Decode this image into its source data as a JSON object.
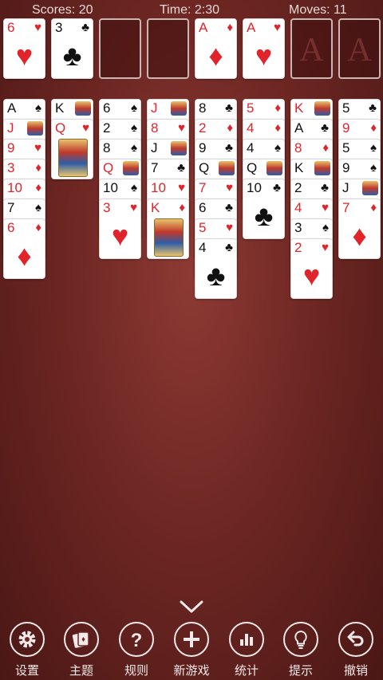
{
  "header": {
    "score": "Scores: 20",
    "time": "Time: 2:30",
    "moves": "Moves: 11"
  },
  "freecells": [
    {
      "rank": "6",
      "suit": "♥",
      "color": "red"
    },
    {
      "rank": "3",
      "suit": "♣",
      "color": "black"
    },
    null,
    null
  ],
  "foundations": [
    {
      "rank": "A",
      "suit": "♦",
      "color": "red"
    },
    {
      "rank": "A",
      "suit": "♥",
      "color": "red"
    },
    {
      "ghost": "A"
    },
    {
      "ghost": "A"
    }
  ],
  "tableau": [
    [
      {
        "rank": "A",
        "suit": "♠"
      },
      {
        "rank": "J",
        "suit": "♦"
      },
      {
        "rank": "9",
        "suit": "♥"
      },
      {
        "rank": "3",
        "suit": "♦"
      },
      {
        "rank": "10",
        "suit": "♦"
      },
      {
        "rank": "7",
        "suit": "♠"
      },
      {
        "rank": "6",
        "suit": "♦"
      }
    ],
    [
      {
        "rank": "K",
        "suit": "♠"
      },
      {
        "rank": "Q",
        "suit": "♥"
      }
    ],
    [
      {
        "rank": "6",
        "suit": "♠"
      },
      {
        "rank": "2",
        "suit": "♠"
      },
      {
        "rank": "8",
        "suit": "♠"
      },
      {
        "rank": "Q",
        "suit": "♦"
      },
      {
        "rank": "10",
        "suit": "♠"
      },
      {
        "rank": "3",
        "suit": "♥"
      }
    ],
    [
      {
        "rank": "J",
        "suit": "♥"
      },
      {
        "rank": "8",
        "suit": "♥"
      },
      {
        "rank": "J",
        "suit": "♠"
      },
      {
        "rank": "7",
        "suit": "♣"
      },
      {
        "rank": "10",
        "suit": "♥"
      },
      {
        "rank": "K",
        "suit": "♦"
      }
    ],
    [
      {
        "rank": "8",
        "suit": "♣"
      },
      {
        "rank": "2",
        "suit": "♦"
      },
      {
        "rank": "9",
        "suit": "♣"
      },
      {
        "rank": "Q",
        "suit": "♣"
      },
      {
        "rank": "7",
        "suit": "♥"
      },
      {
        "rank": "6",
        "suit": "♣"
      },
      {
        "rank": "5",
        "suit": "♥"
      },
      {
        "rank": "4",
        "suit": "♣"
      }
    ],
    [
      {
        "rank": "5",
        "suit": "♦"
      },
      {
        "rank": "4",
        "suit": "♦"
      },
      {
        "rank": "4",
        "suit": "♠"
      },
      {
        "rank": "Q",
        "suit": "♠"
      },
      {
        "rank": "10",
        "suit": "♣"
      }
    ],
    [
      {
        "rank": "K",
        "suit": "♥"
      },
      {
        "rank": "A",
        "suit": "♣"
      },
      {
        "rank": "8",
        "suit": "♦"
      },
      {
        "rank": "K",
        "suit": "♣"
      },
      {
        "rank": "2",
        "suit": "♣"
      },
      {
        "rank": "4",
        "suit": "♥"
      },
      {
        "rank": "3",
        "suit": "♠"
      },
      {
        "rank": "2",
        "suit": "♥"
      }
    ],
    [
      {
        "rank": "5",
        "suit": "♣"
      },
      {
        "rank": "9",
        "suit": "♦"
      },
      {
        "rank": "5",
        "suit": "♠"
      },
      {
        "rank": "9",
        "suit": "♠"
      },
      {
        "rank": "J",
        "suit": "♣"
      },
      {
        "rank": "7",
        "suit": "♦"
      }
    ]
  ],
  "toolbar": [
    {
      "label": "设置",
      "icon": "gear-icon"
    },
    {
      "label": "主题",
      "icon": "theme-icon"
    },
    {
      "label": "规则",
      "icon": "question-icon"
    },
    {
      "label": "新游戏",
      "icon": "plus-icon"
    },
    {
      "label": "统计",
      "icon": "chart-icon"
    },
    {
      "label": "提示",
      "icon": "bulb-icon"
    },
    {
      "label": "撤销",
      "icon": "undo-icon"
    }
  ],
  "colors": {
    "felt": "#6e2723",
    "red_suit": "#e0242a",
    "black_suit": "#111111"
  }
}
